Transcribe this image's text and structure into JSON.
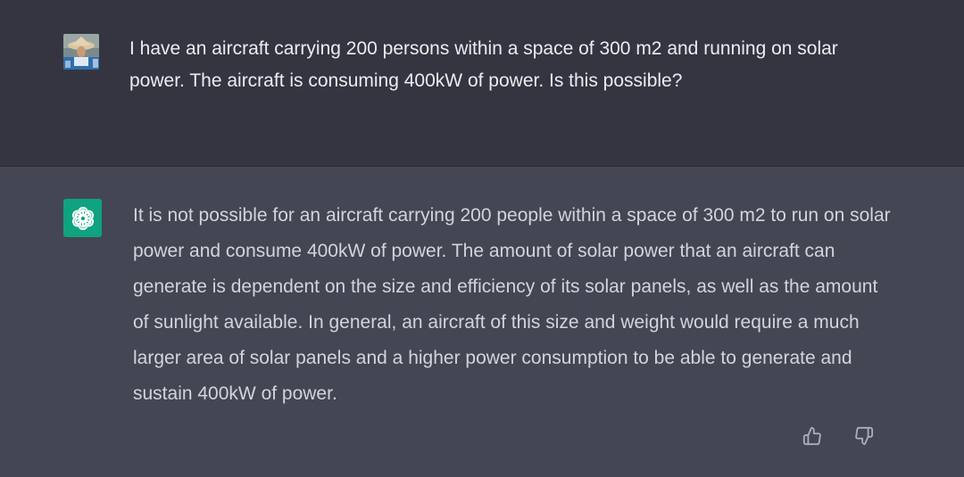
{
  "conversation": {
    "user_message": {
      "avatar_icon": "user-photo-avatar-icon",
      "text": "I have an aircraft carrying 200 persons within a space of 300 m2 and running on solar power. The aircraft is consuming 400kW of power. Is this possible?"
    },
    "assistant_message": {
      "avatar_icon": "openai-logo-icon",
      "text": "It is not possible for an aircraft carrying 200 people within a space of 300 m2 to run on solar power and consume 400kW of power. The amount of solar power that an aircraft can generate is dependent on the size and efficiency of its solar panels, as well as the amount of sunlight available. In general, an aircraft of this size and weight would require a much larger area of solar panels and a higher power consumption to be able to generate and sustain 400kW of power.",
      "feedback_icons": [
        "thumbs-up-icon",
        "thumbs-down-icon"
      ]
    }
  },
  "colors": {
    "user_bg": "#343541",
    "assistant_bg": "#444654",
    "logo_bg": "#10a37f",
    "user_text": "#ececf1",
    "assistant_text": "#d1d5db",
    "icon_color": "#acacbe"
  }
}
